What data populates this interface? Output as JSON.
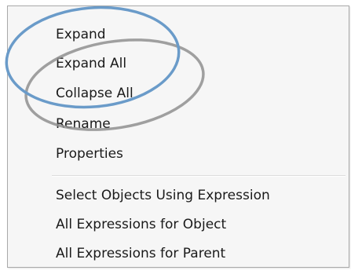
{
  "context_menu": {
    "group1": [
      {
        "label": "Expand"
      },
      {
        "label": "Expand All"
      },
      {
        "label": "Collapse All"
      },
      {
        "label": "Rename"
      },
      {
        "label": "Properties"
      }
    ],
    "group2": [
      {
        "label": "Select Objects Using Expression"
      },
      {
        "label": "All Expressions for Object"
      },
      {
        "label": "All Expressions for Parent"
      }
    ]
  },
  "annotation": {
    "blue_ellipse_color": "#6a9bc9",
    "gray_ellipse_color": "#8f8f8f"
  }
}
